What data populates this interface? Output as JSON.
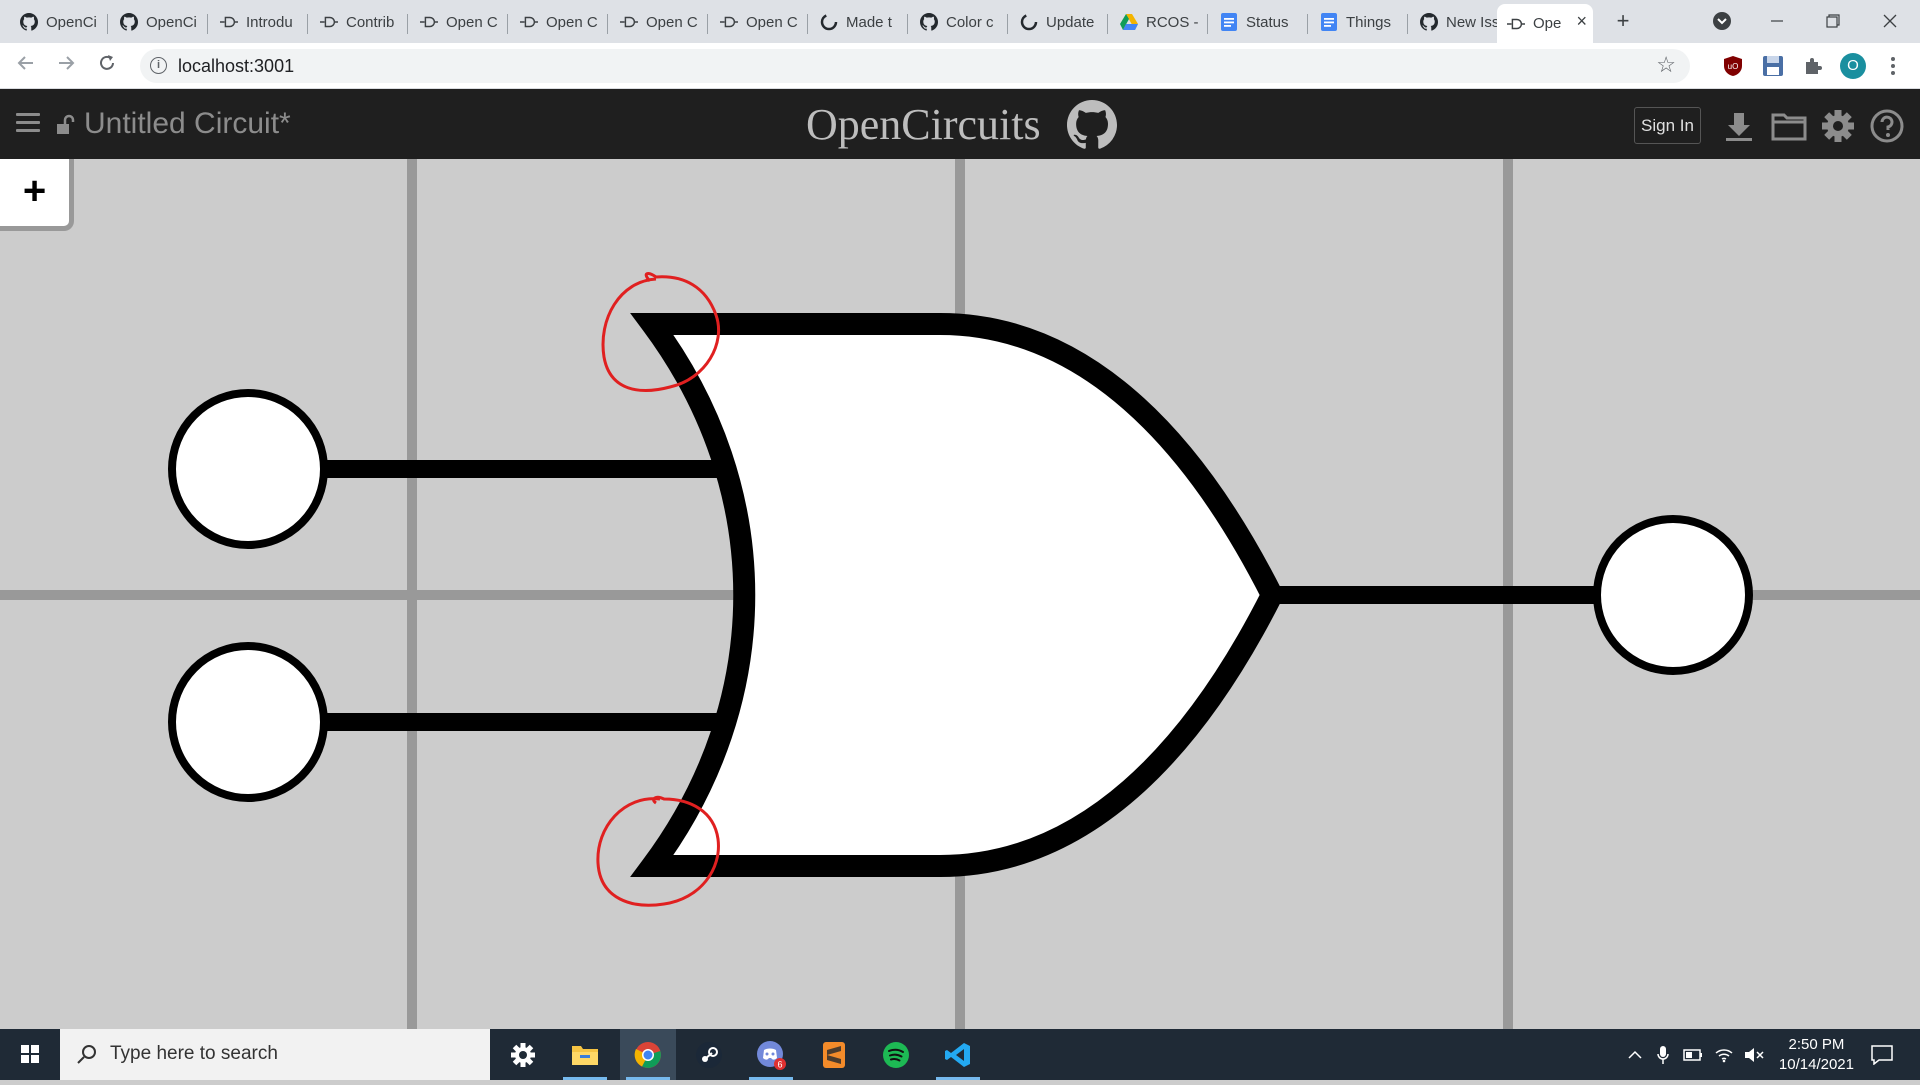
{
  "browser": {
    "tabs": [
      {
        "label": "OpenCi",
        "icon": "github-icon"
      },
      {
        "label": "OpenCi",
        "icon": "github-icon"
      },
      {
        "label": "Introdu",
        "icon": "opencircuits-icon"
      },
      {
        "label": "Contrib",
        "icon": "opencircuits-icon"
      },
      {
        "label": "Open C",
        "icon": "opencircuits-icon"
      },
      {
        "label": "Open C",
        "icon": "opencircuits-icon"
      },
      {
        "label": "Open C",
        "icon": "opencircuits-icon"
      },
      {
        "label": "Open C",
        "icon": "opencircuits-icon"
      },
      {
        "label": "Made t",
        "icon": "github-loading-icon"
      },
      {
        "label": "Color c",
        "icon": "github-icon"
      },
      {
        "label": "Update",
        "icon": "github-loading-icon"
      },
      {
        "label": "RCOS -",
        "icon": "google-drive-icon"
      },
      {
        "label": "Status",
        "icon": "google-docs-icon"
      },
      {
        "label": "Things",
        "icon": "google-docs-icon"
      },
      {
        "label": "New Iss",
        "icon": "github-icon"
      },
      {
        "label": "Ope",
        "icon": "opencircuits-icon",
        "active": true
      }
    ],
    "new_tab": "+",
    "url": "localhost:3001",
    "profile_initial": "O"
  },
  "app": {
    "title": "Untitled Circuit*",
    "brand": "OpenCircuits",
    "sign_in": "Sign In",
    "add_button": "+",
    "brand_color": "#1f1f1f"
  },
  "taskbar": {
    "search_placeholder": "Type here to search",
    "time": "2:50 PM",
    "date": "10/14/2021",
    "discord_badge": "6"
  }
}
